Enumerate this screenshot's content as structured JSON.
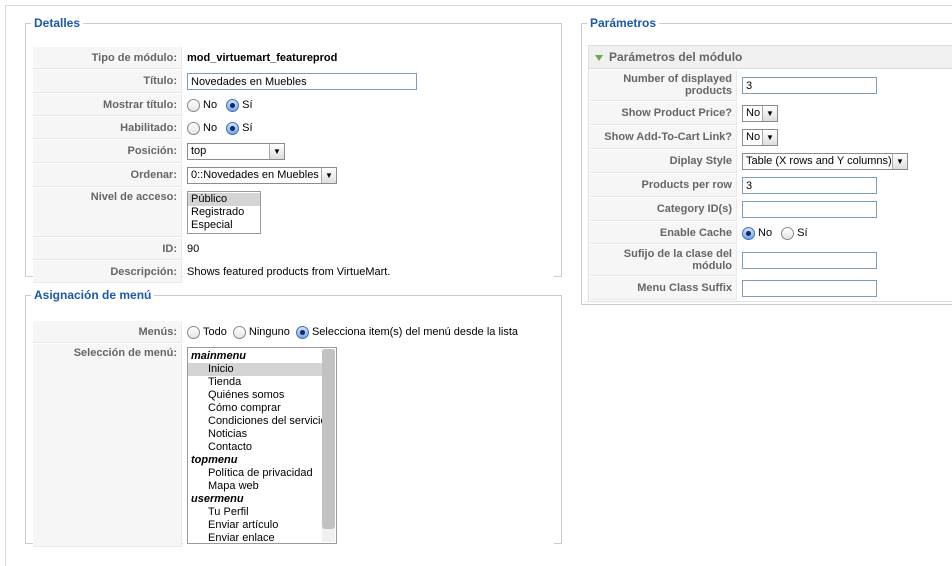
{
  "details": {
    "legend": "Detalles",
    "module_type_label": "Tipo de módulo:",
    "module_type_value": "mod_virtuemart_featureprod",
    "title_label": "Título:",
    "title_value": "Novedades en Muebles",
    "show_title_label": "Mostrar título:",
    "enabled_label": "Habilitado:",
    "no_label": "No",
    "yes_label": "Sí",
    "position_label": "Posición:",
    "position_value": "top",
    "order_label": "Ordenar:",
    "order_value": "0::Novedades en Muebles",
    "access_label": "Nivel de acceso:",
    "access_options": [
      "Público",
      "Registrado",
      "Especial"
    ],
    "id_label": "ID:",
    "id_value": "90",
    "description_label": "Descripción:",
    "description_value": "Shows featured products from VirtueMart."
  },
  "menu_assignment": {
    "legend": "Asignación de menú",
    "menus_label": "Menús:",
    "opt_all": "Todo",
    "opt_none": "Ninguno",
    "opt_select": "Selecciona item(s) del menú desde la lista",
    "selection_label": "Selección de menú:",
    "groups": [
      {
        "name": "mainmenu",
        "items": [
          "Inicio",
          "Tienda",
          "Quiénes somos",
          "Cómo comprar",
          "Condiciones del servicio",
          "Noticias",
          "Contacto"
        ]
      },
      {
        "name": "topmenu",
        "items": [
          "Política de privacidad",
          "Mapa web"
        ]
      },
      {
        "name": "usermenu",
        "items": [
          "Tu Perfil",
          "Enviar artículo",
          "Enviar enlace"
        ]
      }
    ]
  },
  "params": {
    "legend": "Parámetros",
    "panel_title": "Parámetros del módulo",
    "displayed_label": "Number of displayed products",
    "displayed_value": "3",
    "show_price_label": "Show Product Price?",
    "show_price_value": "No",
    "show_cart_label": "Show Add-To-Cart Link?",
    "show_cart_value": "No",
    "display_style_label": "Diplay Style",
    "display_style_value": "Table (X rows and Y columns)",
    "per_row_label": "Products per row",
    "per_row_value": "3",
    "category_label": "Category ID(s)",
    "category_value": "",
    "cache_label": "Enable Cache",
    "cache_no": "No",
    "cache_yes": "Sí",
    "suffix_label": "Sufijo de la clase del módulo",
    "suffix_value": "",
    "menu_suffix_label": "Menu Class Suffix",
    "menu_suffix_value": ""
  }
}
